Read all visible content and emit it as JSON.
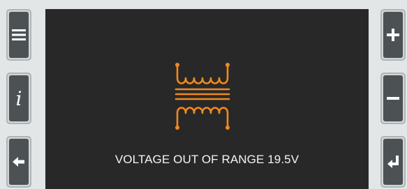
{
  "screen": {
    "background_color": "#282829",
    "status_icon": "transformer-icon",
    "status_icon_color": "#f08a1c",
    "message": "VOLTAGE OUT OF RANGE 19.5V",
    "message_color": "#f4f4f4"
  },
  "left_buttons": [
    {
      "name": "menu-button",
      "icon": "menu-icon"
    },
    {
      "name": "info-button",
      "icon": "info-icon"
    },
    {
      "name": "back-button",
      "icon": "arrow-left-icon"
    }
  ],
  "right_buttons": [
    {
      "name": "plus-button",
      "icon": "plus-icon"
    },
    {
      "name": "minus-button",
      "icon": "minus-icon"
    },
    {
      "name": "enter-button",
      "icon": "enter-icon"
    }
  ]
}
